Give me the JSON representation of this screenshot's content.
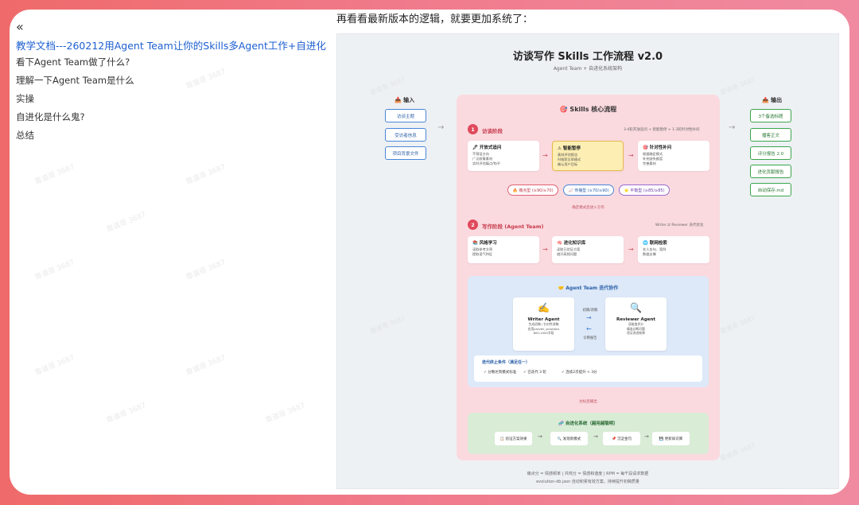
{
  "caption": "再看看最新版本的逻辑，就要更加系统了：",
  "sidebar": {
    "collapse_icon": "«",
    "doc_title": "教学文档---260212用Agent Team让你的Skills多Agent工作+自进化",
    "outline": [
      "看下Agent Team做了什么?",
      "理解一下Agent Team是什么",
      "实操",
      "自进化是什么鬼?",
      "总结"
    ]
  },
  "watermark_text": "靠谱哥 3687",
  "figure": {
    "title": "访谈写作 Skills 工作流程 v2.0",
    "subtitle": "Agent Team + 自进化系统架构",
    "input": {
      "head": "📥 输入",
      "items": [
        "访谈主题",
        "受访者信息",
        "项目背景文件"
      ]
    },
    "output": {
      "head": "📤 输出",
      "items": [
        "3个备选标题",
        "播客正文",
        "评分报告 2.0",
        "进化贡献报告",
        "自动保存.md"
      ]
    },
    "core": {
      "title": "🎯 Skills 核心流程",
      "stage1": {
        "num": "1",
        "label": "访谈阶段",
        "note": "3-4轮开放追问 + 智能暂停 + 1-3轮针对性补问",
        "cards": [
          {
            "title": "🖊 开放式追问",
            "lines": [
              "不预设方向",
              "广泛收集素材",
              "实时评估痛点/钩子"
            ]
          },
          {
            "title": "⚠ 智能暂停",
            "lines": [
              "素材评估报告",
              "AI推荐文章模式",
              "确认用户目标"
            ]
          },
          {
            "title": "🎯 针对性补问",
            "lines": [
              "根据确定模式",
              "补充缺失维度",
              "完善素材"
            ]
          }
        ],
        "pills": [
          "🔥 痛点型 (≥90/≥70)",
          "📈 传播型 (≥70/≥90)",
          "⭐ 平衡型 (≥85/≥85)"
        ],
        "transition": "确定模式后进入写作"
      },
      "stage2": {
        "num": "2",
        "label": "写作阶段 (Agent Team)",
        "note": "Writer ⇄ Reviewer 迭代优化",
        "cards": [
          {
            "title": "📚 风格学习",
            "lines": [
              "读取参考文章",
              "提取语气特征"
            ]
          },
          {
            "title": "🧠 进化知识库",
            "lines": [
              "读取已验证方案",
              "避开高频问题"
            ]
          },
          {
            "title": "🌐 联网检索",
            "lines": [
              "名人金句、案例",
              "数据支撑"
            ]
          }
        ]
      },
      "team": {
        "title": "🤝 Agent Team 迭代协作",
        "writer": {
          "icon": "✍️",
          "name": "Writer Agent",
          "lines": [
            "生成初稿 / 针对性改稿",
            "应用proven_solutions",
            "800-1000字段"
          ]
        },
        "reviewer": {
          "icon": "🔍",
          "name": "Reviewer Agent",
          "lines": [
            "双维度评分",
            "精准诊断问题",
            "验证改进效果"
          ]
        },
        "flow_to": "初稿/改稿",
        "flow_back": "诊断报告",
        "stop": {
          "title": "迭代终止条件（满足任一）",
          "conds": [
            "✓ 分数达到模式标准",
            "✓ 已迭代 3 轮",
            "✓ 连续2次提升 < 3分"
          ]
        }
      },
      "transition2": "达标后输出",
      "evolution": {
        "title": "🧬 自进化系统（越用越聪明）",
        "steps": [
          "📋 验证方案效果",
          "🔍 发现新模式",
          "📌 沉淀金句",
          "💾 更新知识库"
        ]
      }
    },
    "footer": [
      "痛点分 = 情感频率 | 共鸣分 = 情感和谐度 | RPM = 每千段请求数据",
      "evolution-db.json 自动积累有效方案，持续提升初稿质量"
    ]
  }
}
